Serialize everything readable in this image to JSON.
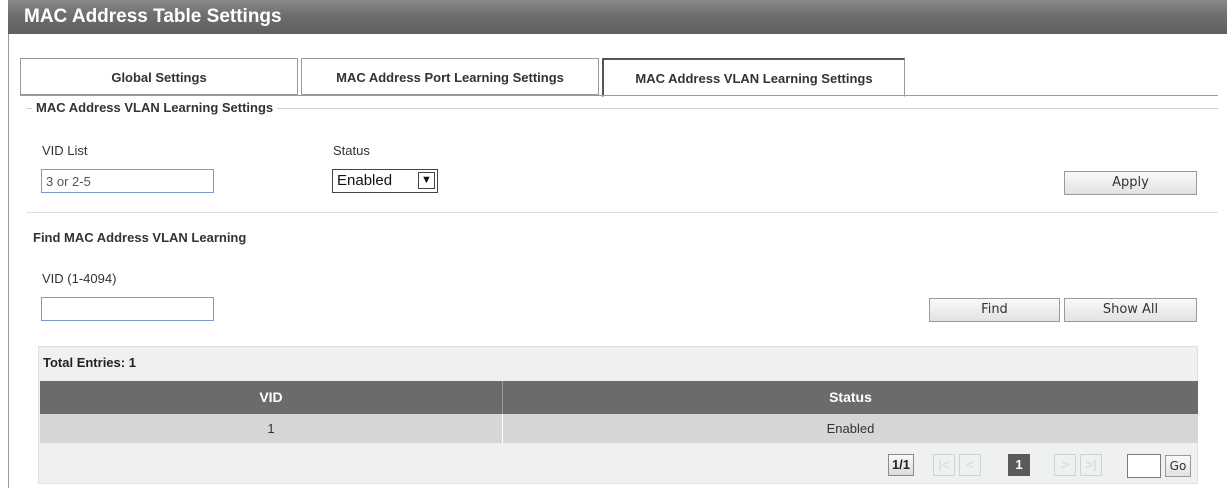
{
  "page": {
    "title": "MAC Address Table Settings"
  },
  "tabs": [
    {
      "label": "Global Settings"
    },
    {
      "label": "MAC Address Port Learning Settings"
    },
    {
      "label": "MAC Address VLAN Learning Settings",
      "active": true
    }
  ],
  "settings": {
    "legend": "MAC Address VLAN Learning Settings",
    "vid_list_label": "VID List",
    "vid_list_value": "3 or 2-5",
    "status_label": "Status",
    "status_value": "Enabled",
    "apply_label": "Apply"
  },
  "find": {
    "title": "Find MAC Address VLAN Learning",
    "vid_label": "VID (1-4094)",
    "vid_value": "",
    "find_label": "Find",
    "show_all_label": "Show All"
  },
  "table": {
    "total_entries": "Total Entries: 1",
    "columns": [
      "VID",
      "Status"
    ],
    "rows": [
      {
        "vid": "1",
        "status": "Enabled"
      }
    ]
  },
  "pager": {
    "page_info": "1/1",
    "first": "|<",
    "prev": "<",
    "current": "1",
    "next": ">",
    "last": ">|",
    "goto_value": "",
    "go_label": "Go"
  }
}
